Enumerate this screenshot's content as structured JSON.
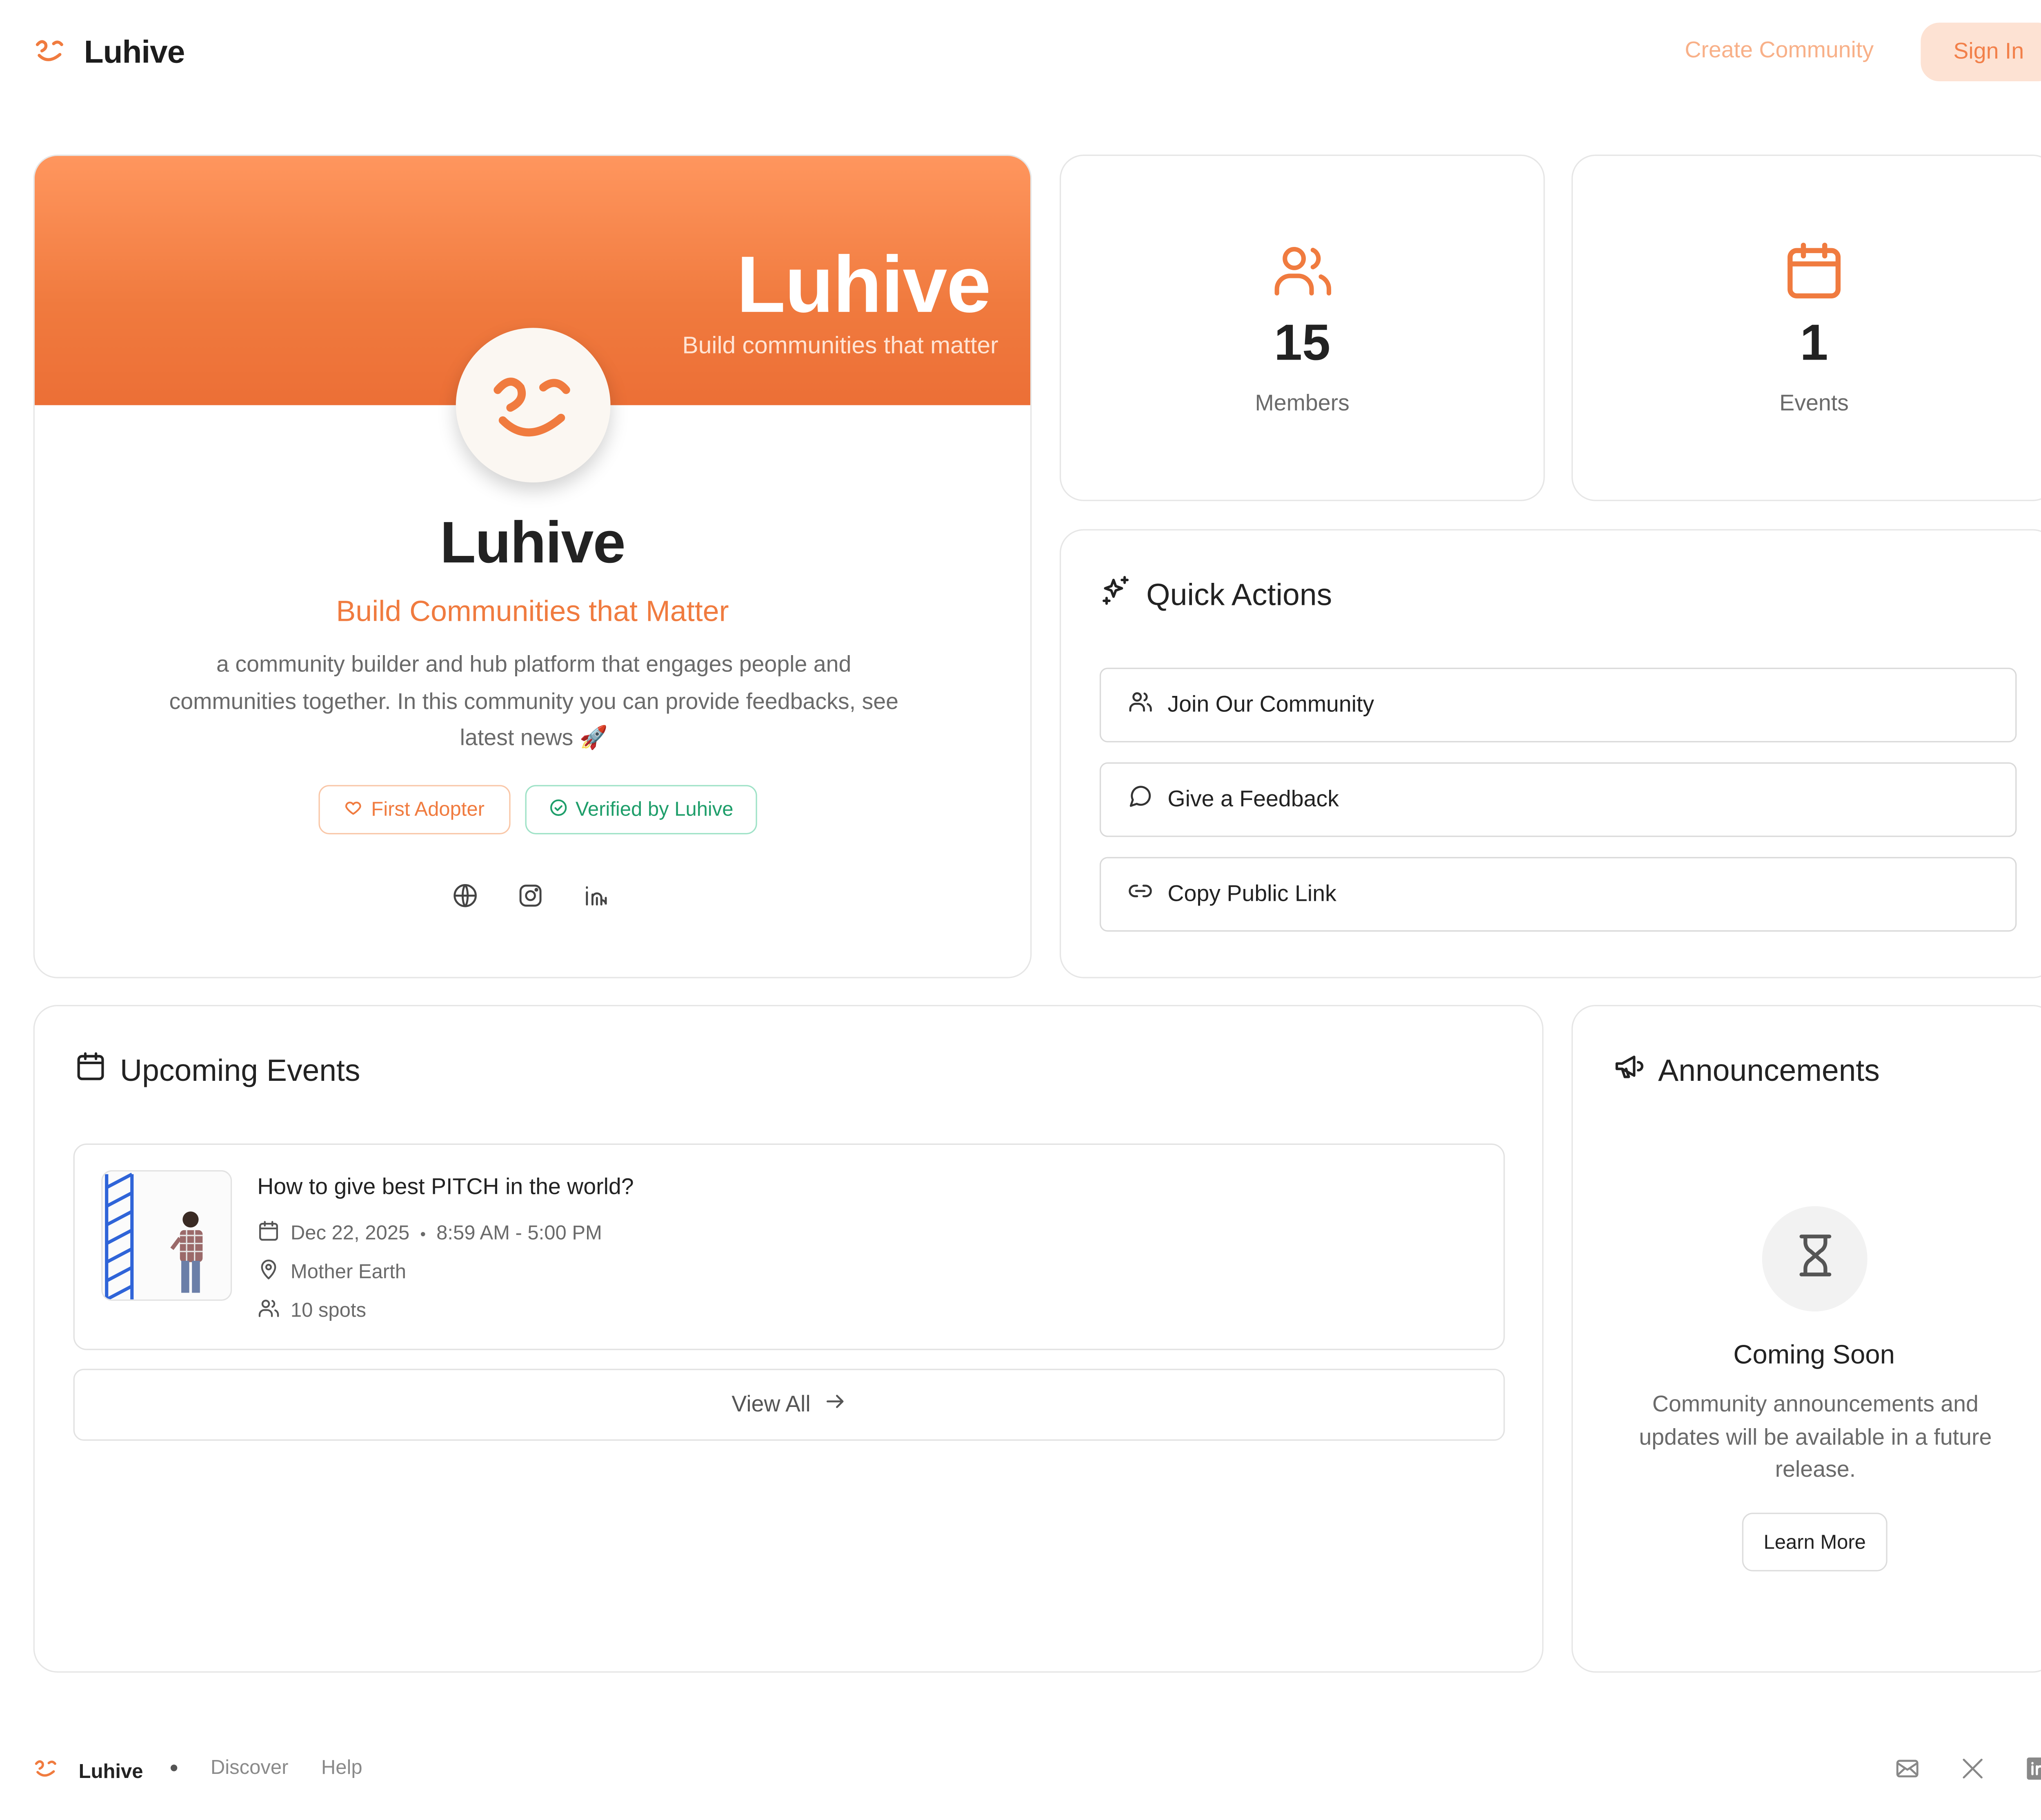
{
  "header": {
    "brand": "Luhive",
    "create_community": "Create Community",
    "sign_in": "Sign In"
  },
  "profile": {
    "banner_title": "Luhive",
    "banner_subtitle": "Build communities that matter",
    "name": "Luhive",
    "tagline": "Build Communities that Matter",
    "description": "a community builder and hub platform that engages people and communities together. In this community you can provide feedbacks, see latest news 🚀",
    "badges": [
      {
        "label": "First Adopter",
        "icon": "heart-icon",
        "color": "#f07b3f"
      },
      {
        "label": "Verified by Luhive",
        "icon": "check-circle-icon",
        "color": "#1e9e6a"
      }
    ],
    "socials": [
      "globe-icon",
      "instagram-icon",
      "linkedin-icon"
    ]
  },
  "stats": {
    "members": {
      "value": "15",
      "label": "Members",
      "icon": "users-icon"
    },
    "events": {
      "value": "1",
      "label": "Events",
      "icon": "calendar-icon"
    }
  },
  "quick_actions": {
    "title": "Quick Actions",
    "icon": "sparkles-icon",
    "items": [
      {
        "label": "Join Our Community",
        "icon": "users-icon"
      },
      {
        "label": "Give a Feedback",
        "icon": "message-circle-icon"
      },
      {
        "label": "Copy Public Link",
        "icon": "link-icon"
      }
    ]
  },
  "upcoming_events": {
    "title": "Upcoming Events",
    "icon": "calendar-icon",
    "events": [
      {
        "title": "How to give best PITCH in the world?",
        "date": "Dec 22, 2025",
        "time": "8:59 AM - 5:00 PM",
        "location": "Mother Earth",
        "spots": "10 spots"
      }
    ],
    "view_all": "View All"
  },
  "announcements": {
    "title": "Announcements",
    "icon": "megaphone-icon",
    "coming_soon_title": "Coming Soon",
    "coming_soon_desc": "Community announcements and updates will be available in a future release.",
    "learn_more": "Learn More"
  },
  "footer": {
    "brand": "Luhive",
    "links": [
      "Discover",
      "Help"
    ],
    "icons": [
      "mail-icon",
      "x-icon",
      "linkedin-icon"
    ]
  },
  "colors": {
    "accent": "#f07b3f",
    "accent_light": "#fde2d3",
    "verified_green": "#1e9e6a"
  }
}
